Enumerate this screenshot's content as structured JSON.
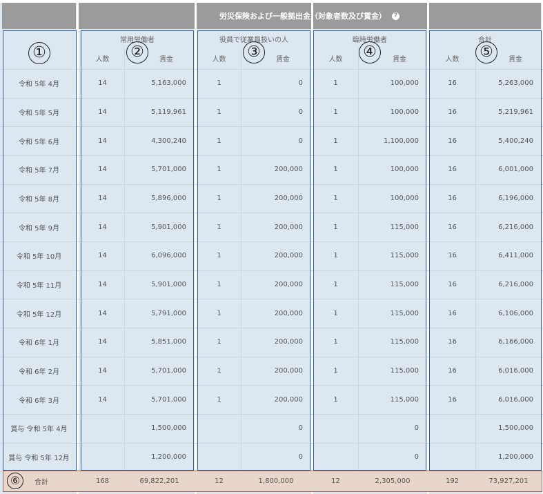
{
  "title": "労災保険および一般拠出金（対象者数及び賃金）",
  "help_icon": "?",
  "groups": [
    {
      "label": "常用労働者",
      "marker": "②"
    },
    {
      "label": "役員で従業員扱いの人",
      "marker": "③"
    },
    {
      "label": "臨時労働者",
      "marker": "④"
    },
    {
      "label": "合計",
      "marker": "⑤"
    }
  ],
  "month_marker": "①",
  "total_marker": "⑥",
  "sub_headers": {
    "count": "人数",
    "wage": "賃金"
  },
  "rows": [
    {
      "month": "令和 5年 4月",
      "c1": "14",
      "w1": "5,163,000",
      "c2": "1",
      "w2": "0",
      "c3": "1",
      "w3": "100,000",
      "c4": "16",
      "w4": "5,263,000"
    },
    {
      "month": "令和 5年 5月",
      "c1": "14",
      "w1": "5,119,961",
      "c2": "1",
      "w2": "0",
      "c3": "1",
      "w3": "100,000",
      "c4": "16",
      "w4": "5,219,961"
    },
    {
      "month": "令和 5年 6月",
      "c1": "14",
      "w1": "4,300,240",
      "c2": "1",
      "w2": "0",
      "c3": "1",
      "w3": "1,100,000",
      "c4": "16",
      "w4": "5,400,240"
    },
    {
      "month": "令和 5年 7月",
      "c1": "14",
      "w1": "5,701,000",
      "c2": "1",
      "w2": "200,000",
      "c3": "1",
      "w3": "100,000",
      "c4": "16",
      "w4": "6,001,000"
    },
    {
      "month": "令和 5年 8月",
      "c1": "14",
      "w1": "5,896,000",
      "c2": "1",
      "w2": "200,000",
      "c3": "1",
      "w3": "100,000",
      "c4": "16",
      "w4": "6,196,000"
    },
    {
      "month": "令和 5年 9月",
      "c1": "14",
      "w1": "5,901,000",
      "c2": "1",
      "w2": "200,000",
      "c3": "1",
      "w3": "115,000",
      "c4": "16",
      "w4": "6,216,000"
    },
    {
      "month": "令和 5年 10月",
      "c1": "14",
      "w1": "6,096,000",
      "c2": "1",
      "w2": "200,000",
      "c3": "1",
      "w3": "115,000",
      "c4": "16",
      "w4": "6,411,000"
    },
    {
      "month": "令和 5年 11月",
      "c1": "14",
      "w1": "5,901,000",
      "c2": "1",
      "w2": "200,000",
      "c3": "1",
      "w3": "115,000",
      "c4": "16",
      "w4": "6,216,000"
    },
    {
      "month": "令和 5年 12月",
      "c1": "14",
      "w1": "5,791,000",
      "c2": "1",
      "w2": "200,000",
      "c3": "1",
      "w3": "115,000",
      "c4": "16",
      "w4": "6,106,000"
    },
    {
      "month": "令和 6年 1月",
      "c1": "14",
      "w1": "5,851,000",
      "c2": "1",
      "w2": "200,000",
      "c3": "1",
      "w3": "115,000",
      "c4": "16",
      "w4": "6,166,000"
    },
    {
      "month": "令和 6年 2月",
      "c1": "14",
      "w1": "5,701,000",
      "c2": "1",
      "w2": "200,000",
      "c3": "1",
      "w3": "115,000",
      "c4": "16",
      "w4": "6,016,000"
    },
    {
      "month": "令和 6年 3月",
      "c1": "14",
      "w1": "5,701,000",
      "c2": "1",
      "w2": "200,000",
      "c3": "1",
      "w3": "115,000",
      "c4": "16",
      "w4": "6,016,000"
    },
    {
      "month": "賞与 令和 5年 4月",
      "c1": "",
      "w1": "1,500,000",
      "c2": "",
      "w2": "0",
      "c3": "",
      "w3": "0",
      "c4": "",
      "w4": "1,500,000"
    },
    {
      "month": "賞与 令和 5年 12月",
      "c1": "",
      "w1": "1,200,000",
      "c2": "",
      "w2": "0",
      "c3": "",
      "w3": "0",
      "c4": "",
      "w4": "1,200,000"
    }
  ],
  "total": {
    "label": "合計",
    "c1": "168",
    "w1": "69,822,201",
    "c2": "12",
    "w2": "1,800,000",
    "c3": "12",
    "w3": "2,305,000",
    "c4": "192",
    "w4": "73,927,201"
  }
}
